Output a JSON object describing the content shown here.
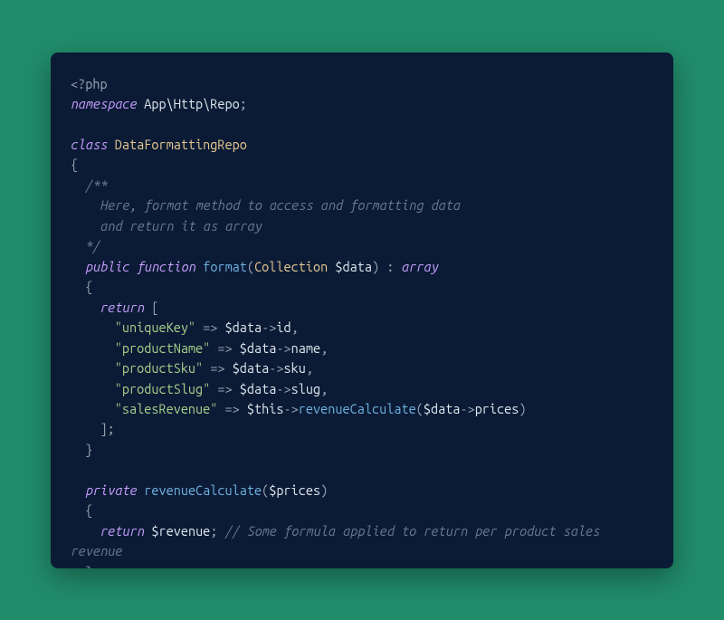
{
  "code": {
    "open_tag": "<?php",
    "namespace_kw": "namespace",
    "namespace_val": "App\\Http\\Repo",
    "class_kw": "class",
    "class_name": "DataFormattingRepo",
    "brace_open": "{",
    "brace_close": "}",
    "doc_open": "/**",
    "doc_line1": "Here, format method to access and formatting data",
    "doc_line2": "and return it as array",
    "doc_close": "*/",
    "public_kw": "public",
    "function_kw": "function",
    "method1_name": "format",
    "param1_type": "Collection",
    "param1_var": "$data",
    "return_type_sep": ":",
    "return_type": "array",
    "return_kw": "return",
    "array_open": "[",
    "array_close": "];",
    "arrow": "=>",
    "obj_arrow": "->",
    "key1": "\"uniqueKey\"",
    "val1_obj": "$data",
    "val1_prop": "id",
    "key2": "\"productName\"",
    "val2_obj": "$data",
    "val2_prop": "name",
    "key3": "\"productSku\"",
    "val3_obj": "$data",
    "val3_prop": "sku",
    "key4": "\"productSlug\"",
    "val4_obj": "$data",
    "val4_prop": "slug",
    "key5": "\"salesRevenue\"",
    "val5_this": "$this",
    "val5_method": "revenueCalculate",
    "val5_arg_obj": "$data",
    "val5_arg_prop": "prices",
    "private_kw": "private",
    "method2_name": "revenueCalculate",
    "param2_var": "$prices",
    "return2_var": "$revenue",
    "semicolon": ";",
    "comma": ",",
    "paren_open": "(",
    "paren_close": ")",
    "inline_comment": "// Some formula applied to return per product sales revenue"
  }
}
